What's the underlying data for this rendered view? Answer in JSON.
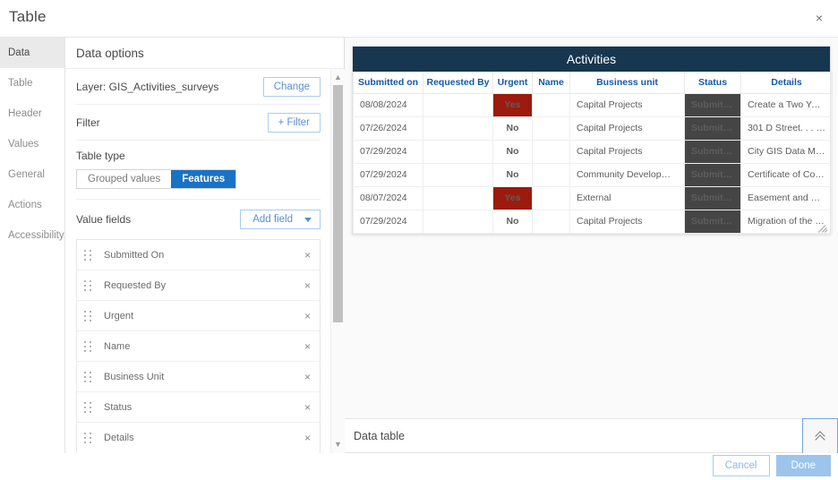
{
  "window": {
    "title": "Table",
    "close_label": "×"
  },
  "sidebar": {
    "items": [
      {
        "label": "Data",
        "active": true
      },
      {
        "label": "Table",
        "active": false
      },
      {
        "label": "Header",
        "active": false
      },
      {
        "label": "Values",
        "active": false
      },
      {
        "label": "General",
        "active": false
      },
      {
        "label": "Actions",
        "active": false
      },
      {
        "label": "Accessibility",
        "active": false
      }
    ]
  },
  "options": {
    "header": "Data options",
    "layer_label": "Layer: GIS_Activities_surveys",
    "change_button": "Change",
    "filter_label": "Filter",
    "add_filter_button": "+ Filter",
    "table_type_label": "Table type",
    "table_type_options": [
      {
        "label": "Grouped values",
        "selected": false
      },
      {
        "label": "Features",
        "selected": true
      }
    ],
    "value_fields_label": "Value fields",
    "add_field_button": "Add field",
    "fields": [
      {
        "name": "Submitted On",
        "remove": "×"
      },
      {
        "name": "Requested By",
        "remove": "×"
      },
      {
        "name": "Urgent",
        "remove": "×"
      },
      {
        "name": "Name",
        "remove": "×"
      },
      {
        "name": "Business Unit",
        "remove": "×"
      },
      {
        "name": "Status",
        "remove": "×"
      },
      {
        "name": "Details",
        "remove": "×"
      }
    ],
    "scroll_up": "▲",
    "scroll_down": "▼"
  },
  "preview": {
    "widget_title": "Activities",
    "columns": [
      "Submitted on",
      "Requested By",
      "Urgent",
      "Name",
      "Business unit",
      "Status",
      "Details"
    ],
    "rows": [
      {
        "submitted_on": "08/08/2024",
        "requested_by": "",
        "urgent": "Yes",
        "urgent_flag": true,
        "name": "",
        "business_unit": "Capital Projects",
        "status": "Submitted",
        "details": "Create a Two Yea…"
      },
      {
        "submitted_on": "07/26/2024",
        "requested_by": "",
        "urgent": "No",
        "urgent_flag": false,
        "name": "",
        "business_unit": "Capital Projects",
        "status": "Submitted",
        "details": "301 D Street. . . . . ."
      },
      {
        "submitted_on": "07/29/2024",
        "requested_by": "",
        "urgent": "No",
        "urgent_flag": false,
        "name": "",
        "business_unit": "Capital Projects",
        "status": "Submitted",
        "details": "City GIS Data Ma…"
      },
      {
        "submitted_on": "07/29/2024",
        "requested_by": "",
        "urgent": "No",
        "urgent_flag": false,
        "name": "",
        "business_unit": "Community Development",
        "status": "Submitted",
        "details": "Certificate of Co…"
      },
      {
        "submitted_on": "08/07/2024",
        "requested_by": "",
        "urgent": "Yes",
        "urgent_flag": true,
        "name": "",
        "business_unit": "External",
        "status": "Submitted",
        "details": "Easement and Ri…"
      },
      {
        "submitted_on": "07/29/2024",
        "requested_by": "",
        "urgent": "No",
        "urgent_flag": false,
        "name": "",
        "business_unit": "Capital Projects",
        "status": "Submitted",
        "details": "Migration of the …"
      }
    ]
  },
  "datatable_bar": {
    "label": "Data table"
  },
  "footer": {
    "cancel_label": "Cancel",
    "done_label": "Done"
  },
  "colors": {
    "widget_header": "#17364f",
    "accent_blue": "#1a72c4",
    "urgent_red": "#9c1a0e",
    "status_gray": "#454545",
    "header_text_blue": "#1558a8"
  }
}
